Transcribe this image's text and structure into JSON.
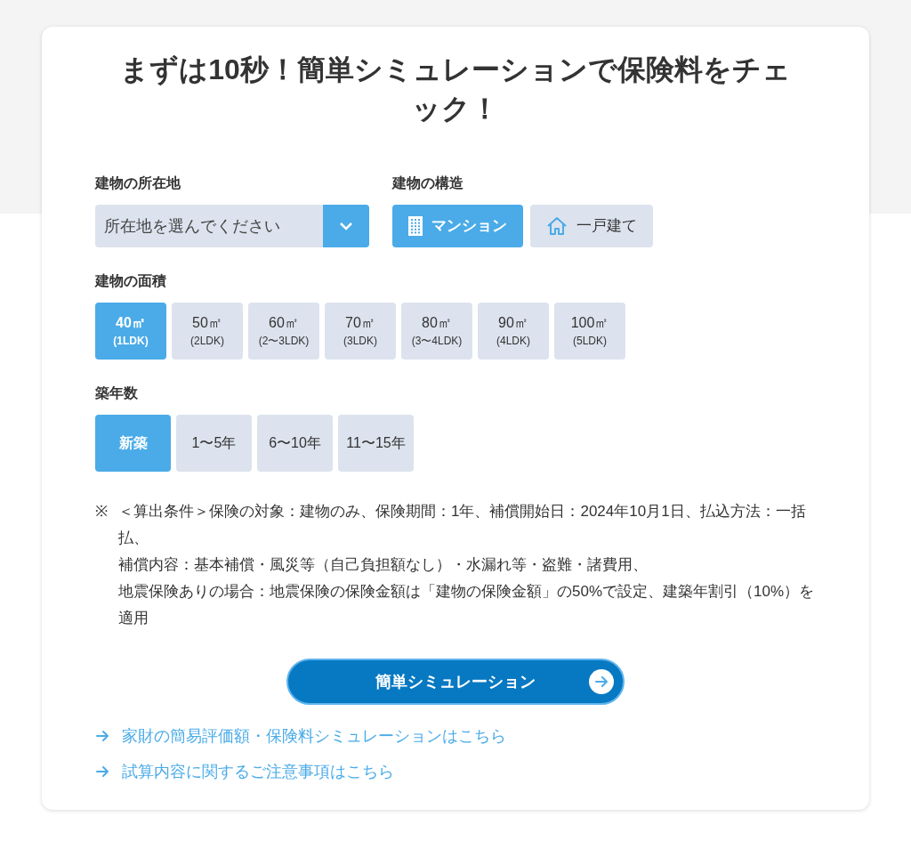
{
  "title": "まずは10秒！簡単シミュレーションで保険料をチェック！",
  "location": {
    "label": "建物の所在地",
    "placeholder": "所在地を選んでください"
  },
  "structure": {
    "label": "建物の構造",
    "options": [
      {
        "label": "マンション",
        "kind": "building",
        "selected": true
      },
      {
        "label": "一戸建て",
        "kind": "house",
        "selected": false
      }
    ]
  },
  "area": {
    "label": "建物の面積",
    "options": [
      {
        "label": "40㎡",
        "sub": "(1LDK)",
        "selected": true
      },
      {
        "label": "50㎡",
        "sub": "(2LDK)",
        "selected": false
      },
      {
        "label": "60㎡",
        "sub": "(2〜3LDK)",
        "selected": false
      },
      {
        "label": "70㎡",
        "sub": "(3LDK)",
        "selected": false
      },
      {
        "label": "80㎡",
        "sub": "(3〜4LDK)",
        "selected": false
      },
      {
        "label": "90㎡",
        "sub": "(4LDK)",
        "selected": false
      },
      {
        "label": "100㎡",
        "sub": "(5LDK)",
        "selected": false
      }
    ]
  },
  "age": {
    "label": "築年数",
    "options": [
      {
        "label": "新築",
        "selected": true
      },
      {
        "label": "1〜5年",
        "selected": false
      },
      {
        "label": "6〜10年",
        "selected": false
      },
      {
        "label": "11〜15年",
        "selected": false
      }
    ]
  },
  "note": {
    "mark": "※",
    "lines": [
      "＜算出条件＞保険の対象：建物のみ、保険期間：1年、補償開始日：2024年10月1日、払込方法：一括払、",
      "補償内容：基本補償・風災等（自己負担額なし）・水漏れ等・盗難・諸費用、",
      "地震保険ありの場合：地震保険の保険金額は「建物の保険金額」の50%で設定、建築年割引（10%）を適用"
    ]
  },
  "submit": "簡単シミュレーション",
  "links": [
    "家財の簡易評価額・保険料シミュレーションはこちら",
    "試算内容に関するご注意事項はこちら"
  ]
}
